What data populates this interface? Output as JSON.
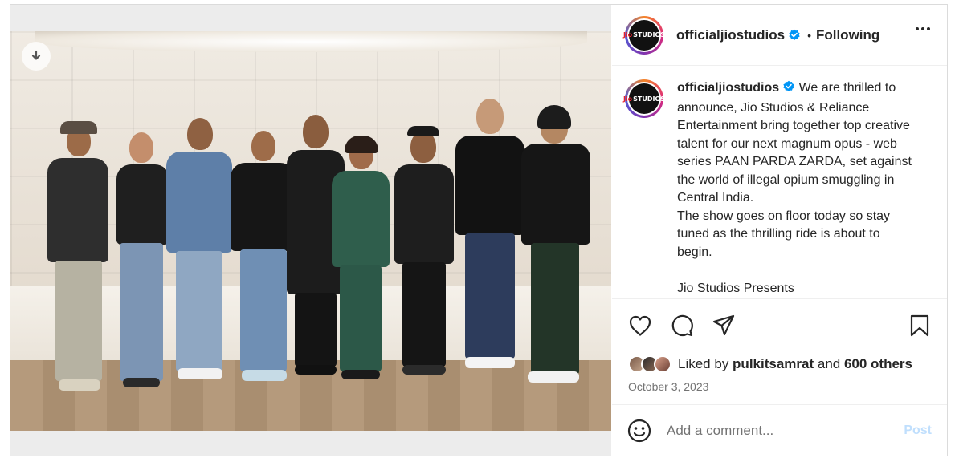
{
  "post": {
    "account": {
      "username": "officialjiostudios",
      "verified": true,
      "avatar_logo_brand": "Jio",
      "avatar_logo_text": "STUDIOS",
      "separator": "•",
      "follow_state": "Following"
    },
    "media": {
      "download_icon": "download-arrow-icon",
      "alt": "Group photo of Paan Parda Zarda team"
    },
    "caption": {
      "username": "officialjiostudios",
      "text": " We are thrilled to announce, Jio Studios & Reliance Entertainment bring together top creative talent for our next magnum opus - web series PAAN PARDA ZARDA, set against the world of illegal opium smuggling in Central India.\nThe show goes on floor today so stay tuned as the thrilling ride is about to begin.\n\nJio Studios Presents"
    },
    "actions": {
      "like_icon": "heart-icon",
      "comment_icon": "comment-icon",
      "share_icon": "send-icon",
      "save_icon": "bookmark-icon"
    },
    "likes": {
      "prefix": "Liked by ",
      "user": "pulkitsamrat",
      "middle": " and ",
      "others": "600 others"
    },
    "date": "October 3, 2023",
    "comment": {
      "placeholder": "Add a comment...",
      "post_label": "Post",
      "emoji_icon": "smiley-icon"
    },
    "colors": {
      "verified_blue": "#0095f6",
      "post_disabled": "#c0dffd",
      "muted_text": "#737373",
      "jio_red": "#e8212c"
    }
  }
}
